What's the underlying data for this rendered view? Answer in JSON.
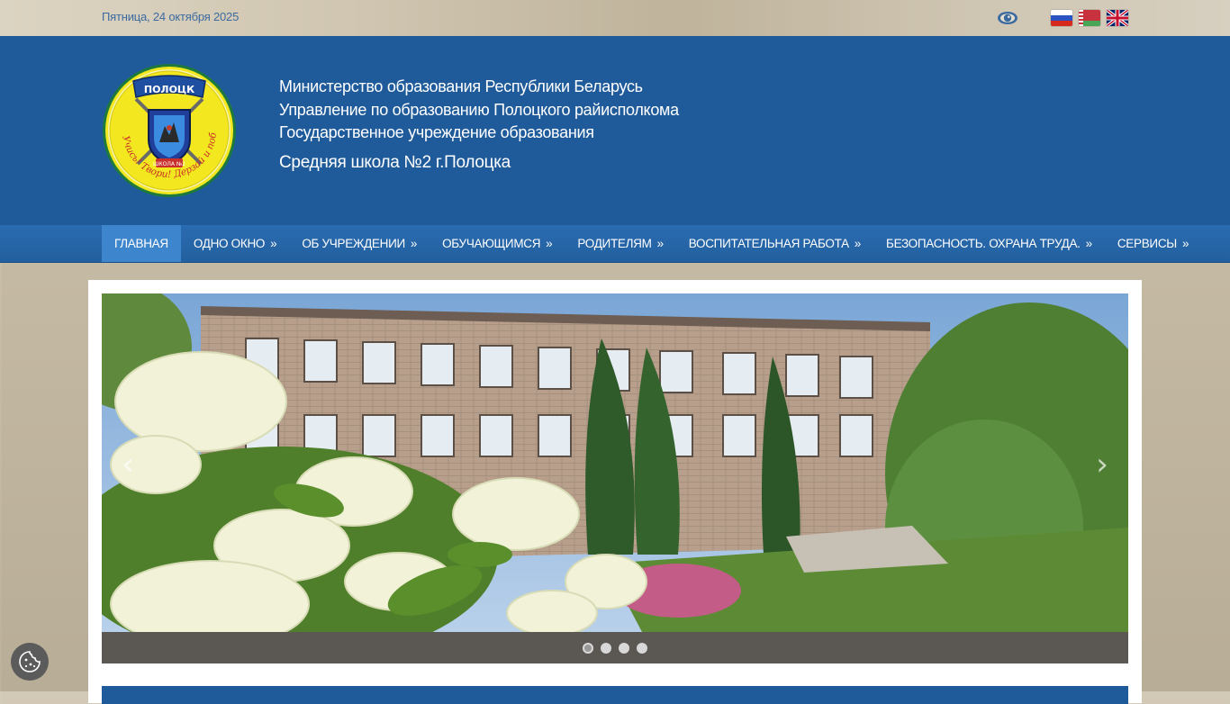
{
  "topbar": {
    "date": "Пятница, 24 октября 2025",
    "flags": [
      {
        "name": "flag-ru-icon",
        "lang": "Русский"
      },
      {
        "name": "flag-by-icon",
        "lang": "Беларуская"
      },
      {
        "name": "flag-en-icon",
        "lang": "English"
      }
    ]
  },
  "header": {
    "logo_text_top": "ПОЛОЦК",
    "logo_text_ring": "Учись! Твори! Дерзай и побеждай!",
    "logo_text_badge": "ШКОЛА №2",
    "line1": "Министерство образования Республики Беларусь",
    "line2": "Управление по образованию Полоцкого райисполкома",
    "line3": "Государственное учреждение образования",
    "school": "Средняя школа №2 г.Полоцка"
  },
  "nav": {
    "items": [
      {
        "label": "ГЛАВНАЯ",
        "arrow": "",
        "active": true
      },
      {
        "label": "ОДНО ОКНО",
        "arrow": "»"
      },
      {
        "label": "ОБ УЧРЕЖДЕНИИ",
        "arrow": "»"
      },
      {
        "label": "ОБУЧАЮЩИМСЯ",
        "arrow": "»"
      },
      {
        "label": "РОДИТЕЛЯМ",
        "arrow": "»"
      },
      {
        "label": "ВОСПИТАТЕЛЬНАЯ РАБОТА",
        "arrow": "»"
      },
      {
        "label": "БЕЗОПАСНОСТЬ. ОХРАНА ТРУДА.",
        "arrow": "»"
      },
      {
        "label": "СЕРВИСЫ",
        "arrow": "»"
      }
    ]
  },
  "slider": {
    "prev": "‹",
    "next": "›",
    "slide_count": 4,
    "active_slide": 1
  },
  "colors": {
    "header_blue": "#1f5b9b",
    "nav_active": "#3d85cc",
    "date_text": "#3b6aa0"
  }
}
